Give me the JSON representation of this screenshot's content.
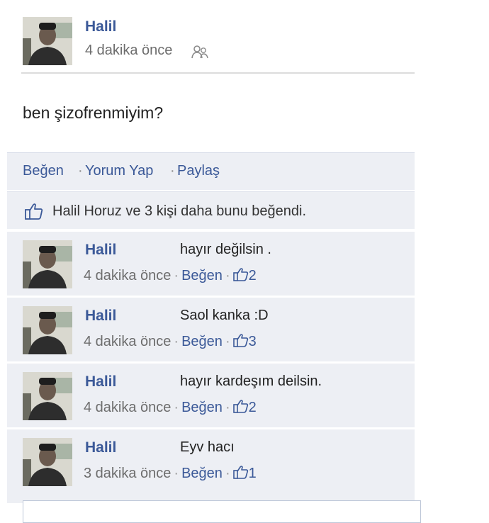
{
  "post": {
    "author": "Halil",
    "time": "4 dakika önce",
    "privacy_icon": "friends-icon",
    "status": "ben şizofrenmiyim?"
  },
  "actions": {
    "like": "Beğen",
    "comment": "Yorum Yap",
    "share": "Paylaş",
    "separator": "·"
  },
  "likes": {
    "text": "Halil Horuz ve 3 kişi daha bunu beğendi.",
    "icon": "thumbs-up-icon"
  },
  "comments": [
    {
      "author": "Halil",
      "text": "hayır değilsin .",
      "time": "4 dakika önce",
      "like_label": "Beğen",
      "like_count": "2"
    },
    {
      "author": "Halil",
      "text": "Saol kanka :D",
      "time": "4 dakika önce",
      "like_label": "Beğen",
      "like_count": "3"
    },
    {
      "author": "Halil",
      "text": "hayır kardeşım deilsin.",
      "time": "4 dakika önce",
      "like_label": "Beğen",
      "like_count": "2"
    },
    {
      "author": "Halil",
      "text": "Eyv hacı",
      "time": "3 dakika önce",
      "like_label": "Beğen",
      "like_count": "1"
    }
  ],
  "colors": {
    "link": "#3b5998",
    "panel": "#edeff4",
    "meta": "#6d6d6d"
  }
}
